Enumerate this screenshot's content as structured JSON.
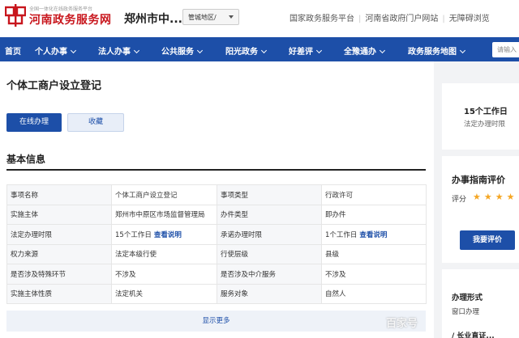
{
  "header": {
    "slogan": "全国一体化在线政务服务平台",
    "site_name": "河南政务服务网",
    "city": "郑州市中...",
    "region_select": "管城地区/",
    "top_links": [
      "国家政务服务平台",
      "河南省政府门户网站",
      "无障碍浏览"
    ],
    "brand_color": "#c8161d"
  },
  "nav": {
    "color": "#1d4fa8",
    "items": [
      {
        "label": "首页",
        "dropdown": false
      },
      {
        "label": "个人办事",
        "dropdown": true
      },
      {
        "label": "法人办事",
        "dropdown": true
      },
      {
        "label": "公共服务",
        "dropdown": true
      },
      {
        "label": "阳光政务",
        "dropdown": true
      },
      {
        "label": "好差评",
        "dropdown": true
      },
      {
        "label": "全豫通办",
        "dropdown": true
      },
      {
        "label": "政务服务地图",
        "dropdown": true
      }
    ],
    "search_placeholder": "请输入"
  },
  "main": {
    "title": "个体工商户设立登记",
    "online_button": "在线办理",
    "fav_button": "收藏",
    "section_title": "基本信息",
    "rows": [
      {
        "k1": "事项名称",
        "v1": "个体工商户设立登记",
        "k2": "事项类型",
        "v2": "行政许可"
      },
      {
        "k1": "实施主体",
        "v1": "郑州市中原区市场监督管理局",
        "k2": "办件类型",
        "v2": "即办件"
      },
      {
        "k1": "法定办理时限",
        "v1": "15个工作日",
        "v1_link": "查看说明",
        "k2": "承诺办理时限",
        "v2": "1个工作日",
        "v2_link": "查看说明"
      },
      {
        "k1": "权力来源",
        "v1": "法定本级行使",
        "k2": "行使层级",
        "v2": "县级"
      },
      {
        "k1": "是否涉及特殊环节",
        "v1": "不涉及",
        "k2": "是否涉及中介服务",
        "v2": "不涉及"
      },
      {
        "k1": "实施主体性质",
        "v1": "法定机关",
        "k2": "服务对象",
        "v2": "自然人"
      }
    ],
    "show_more": "显示更多"
  },
  "side": {
    "days": "15个工作日",
    "days_label": "法定办理时限",
    "eval_title": "办事指南评价",
    "score_label": "评分",
    "stars": "★★★★",
    "eval_button": "我要评价",
    "form_title": "办理形式",
    "form_value": "窗口办理",
    "extra": "/ 长业直证..."
  },
  "watermark": "百家号"
}
